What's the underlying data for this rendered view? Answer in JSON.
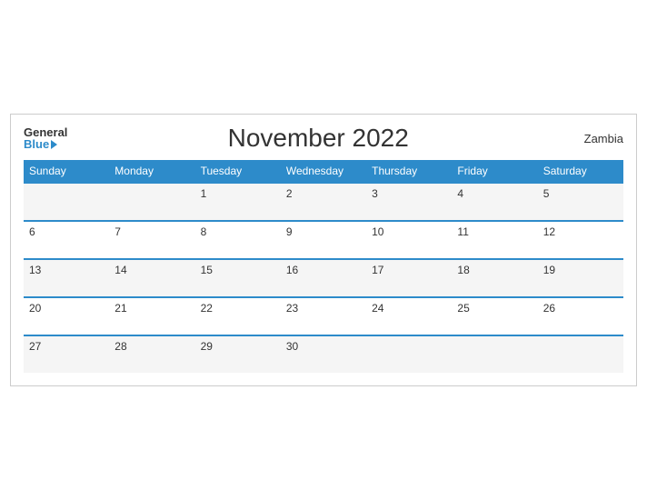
{
  "header": {
    "logo_general": "General",
    "logo_blue": "Blue",
    "title": "November 2022",
    "country": "Zambia"
  },
  "weekdays": [
    "Sunday",
    "Monday",
    "Tuesday",
    "Wednesday",
    "Thursday",
    "Friday",
    "Saturday"
  ],
  "weeks": [
    [
      "",
      "",
      "1",
      "2",
      "3",
      "4",
      "5"
    ],
    [
      "6",
      "7",
      "8",
      "9",
      "10",
      "11",
      "12"
    ],
    [
      "13",
      "14",
      "15",
      "16",
      "17",
      "18",
      "19"
    ],
    [
      "20",
      "21",
      "22",
      "23",
      "24",
      "25",
      "26"
    ],
    [
      "27",
      "28",
      "29",
      "30",
      "",
      "",
      ""
    ]
  ]
}
